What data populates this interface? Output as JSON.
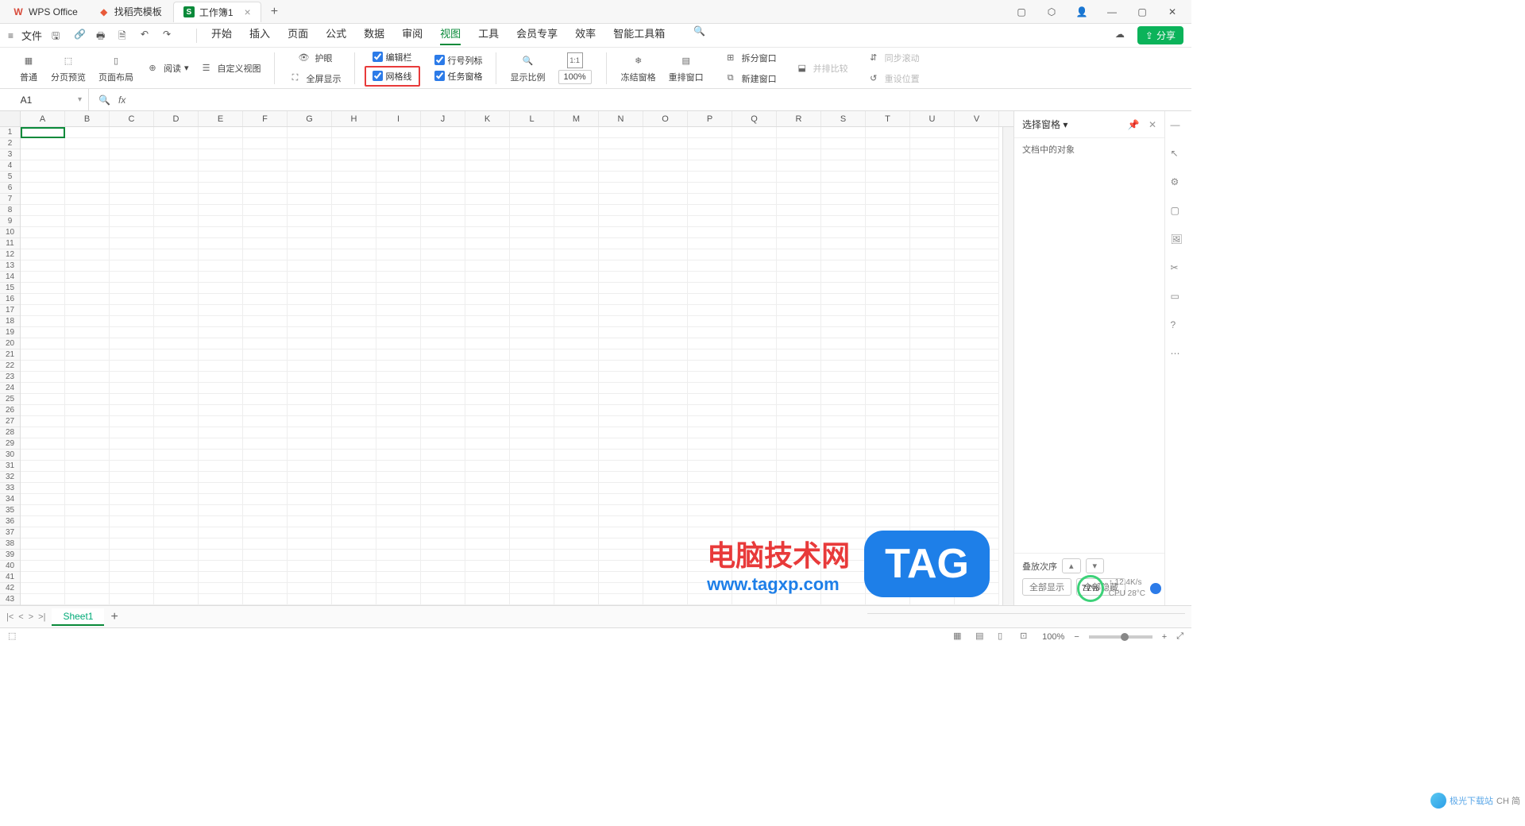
{
  "colors": {
    "accent": "#0a8a3a",
    "highlight": "#e83a3a",
    "link": "#1e7fe8"
  },
  "titlebar": {
    "tabs": [
      {
        "label": "WPS Office",
        "icon": "wps-logo-icon"
      },
      {
        "label": "找稻壳模板",
        "icon": "docer-icon"
      },
      {
        "label": "工作簿1",
        "icon": "sheet-icon",
        "active": true
      }
    ],
    "plus": "+"
  },
  "menubar": {
    "file": "文件",
    "tabs": [
      "开始",
      "插入",
      "页面",
      "公式",
      "数据",
      "审阅",
      "视图",
      "工具",
      "会员专享",
      "效率",
      "智能工具箱"
    ],
    "active_tab": "视图",
    "share": "分享"
  },
  "ribbon": {
    "views": {
      "normal": "普通",
      "page_preview": "分页预览",
      "page_layout": "页面布局",
      "reading": "阅读",
      "custom": "自定义视图"
    },
    "eye_protect": "护眼",
    "full_screen": "全屏显示",
    "checkboxes": {
      "edit_bar": "编辑栏",
      "row_col_label": "行号列标",
      "gridlines": "网格线",
      "task_pane": "任务窗格"
    },
    "zoom_label": "显示比例",
    "zoom_value": "100%",
    "freeze": "冻结窗格",
    "rearrange": "重排窗口",
    "split": "拆分窗口",
    "new_window": "新建窗口",
    "side_by_side": "并排比较",
    "sync_scroll": "同步滚动",
    "reset_pos": "重设位置"
  },
  "formula_bar": {
    "cell_ref": "A1",
    "fx": "fx"
  },
  "grid": {
    "columns": [
      "A",
      "B",
      "C",
      "D",
      "E",
      "F",
      "G",
      "H",
      "I",
      "J",
      "K",
      "L",
      "M",
      "N",
      "O",
      "P",
      "Q",
      "R",
      "S",
      "T",
      "U",
      "V"
    ],
    "row_count": 43
  },
  "right_panel": {
    "title": "选择窗格",
    "subtitle": "文档中的对象",
    "order": "叠放次序",
    "show_all": "全部显示",
    "hide_all": "全部隐藏",
    "percent": "77%",
    "stat1": "12.4K/s",
    "stat2": "CPU 28°C"
  },
  "sheet_tabs": {
    "sheet1": "Sheet1",
    "add": "+"
  },
  "statusbar": {
    "zoom": "100%",
    "ime": "CH 简"
  },
  "watermark": {
    "line1": "电脑技术网",
    "line2": "www.tagxp.com",
    "tag": "TAG"
  },
  "branding": {
    "text": "极光下载站"
  }
}
